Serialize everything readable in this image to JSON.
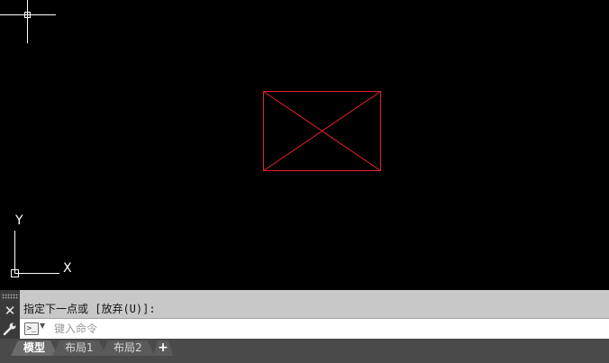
{
  "drawing": {
    "ucs_y_label": "Y",
    "ucs_x_label": "X",
    "object_color": "#e8202a",
    "crosshair_color": "#ffffff"
  },
  "command_line": {
    "history_text": "指定下一点或 [放弃(U)]:",
    "input_placeholder": "键入命令",
    "input_value": "",
    "prompt_icon": ">_",
    "close_icon": "✕"
  },
  "tabs": [
    {
      "label": "模型",
      "active": true
    },
    {
      "label": "布局1",
      "active": false
    },
    {
      "label": "布局2",
      "active": false
    }
  ],
  "add_tab_label": "+"
}
